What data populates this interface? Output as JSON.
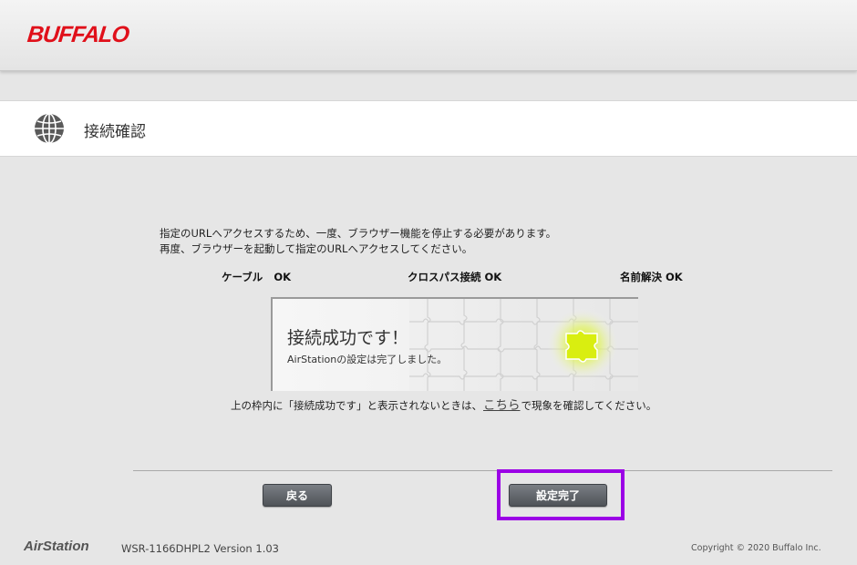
{
  "header": {
    "logo_text": "BUFFALO"
  },
  "page": {
    "title": "接続確認",
    "icon": "globe-icon"
  },
  "message": {
    "line1": "指定のURLへアクセスするため、一度、ブラウザー機能を停止する必要があります。",
    "line2": "再度、ブラウザーを起動して指定のURLへアクセスしてください。"
  },
  "status": {
    "cable": {
      "label": "ケーブル",
      "value": "OK"
    },
    "crosspass": {
      "label": "クロスパス接続",
      "value": "OK"
    },
    "dns": {
      "label": "名前解決",
      "value": "OK"
    }
  },
  "success_box": {
    "title": "接続成功です！",
    "subtitle": "AirStationの設定は完了しました。"
  },
  "note": {
    "before": "上の枠内に「接続成功です」と表示されないときは、",
    "link": "こちら",
    "after": "で現象を確認してください。"
  },
  "buttons": {
    "back": "戻る",
    "done": "設定完了"
  },
  "footer": {
    "brand": "AirStation",
    "version": "WSR-1166DHPL2 Version 1.03",
    "copyright": "Copyright © 2020 Buffalo Inc."
  },
  "colors": {
    "logo": "#e0101a",
    "highlight": "#9b00e6",
    "button": "#5f6369"
  }
}
